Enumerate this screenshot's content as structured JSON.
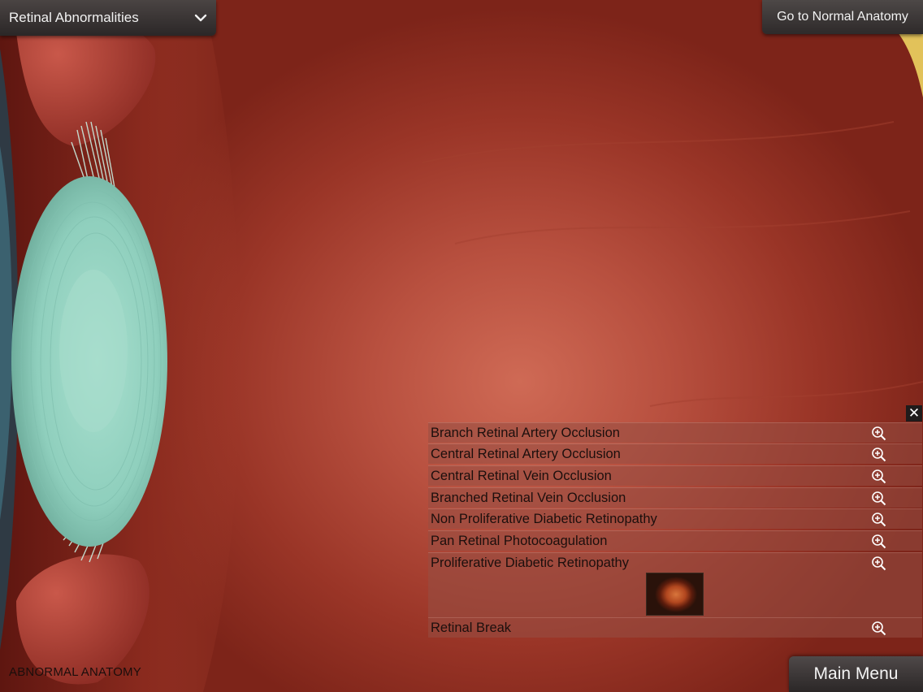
{
  "dropdown": {
    "label": "Retinal Abnormalities"
  },
  "header": {
    "normal_anatomy_label": "Go to Normal Anatomy"
  },
  "close_label": "✕",
  "list": {
    "items": [
      {
        "label": "Branch Retinal Artery Occlusion"
      },
      {
        "label": "Central Retinal Artery Occlusion"
      },
      {
        "label": "Central Retinal Vein Occlusion"
      },
      {
        "label": "Branched Retinal Vein Occlusion"
      },
      {
        "label": "Non Proliferative Diabetic Retinopathy"
      },
      {
        "label": "Pan Retinal Photocoagulation"
      },
      {
        "label": "Proliferative Diabetic Retinopathy",
        "expanded": true
      },
      {
        "label": "Retinal Break"
      }
    ],
    "row_icon": "zoom-in-icon"
  },
  "footer": {
    "mode_caption": "ABNORMAL ANATOMY",
    "main_menu_label": "Main Menu"
  },
  "colors": {
    "retina_center": "#cf6a55",
    "retina_edge": "#7d2419",
    "lens": "#8fcfbd",
    "button_bg": "#2e2a2a",
    "button_text": "#f2f2f2"
  }
}
